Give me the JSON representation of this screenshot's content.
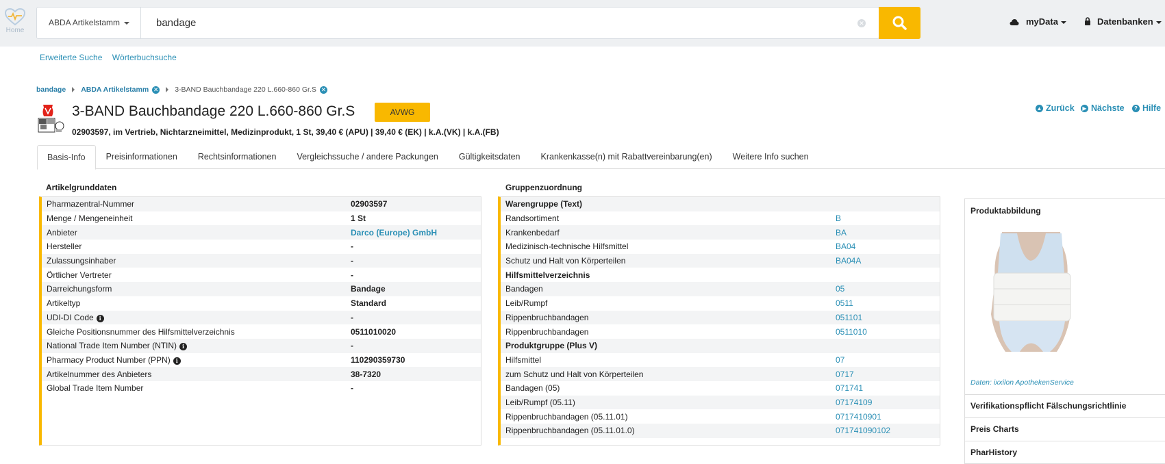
{
  "header": {
    "home_label": "Home",
    "db_select": "ABDA Artikelstamm",
    "search_value": "bandage",
    "mydata": "myData",
    "datenbanken": "Datenbanken"
  },
  "sublinks": [
    "Erweiterte Suche",
    "Wörterbuchsuche"
  ],
  "breadcrumb": {
    "items": [
      "bandage",
      "ABDA Artikelstamm",
      "3-BAND Bauchbandage 220 L.660-860 Gr.S"
    ]
  },
  "product": {
    "title": "3-BAND Bauchbandage 220 L.660-860 Gr.S",
    "badge": "AVWG",
    "subline": "02903597, im Vertrieb, Nichtarzneimittel, Medizinprodukt, 1 St, 39,40 € (APU) | 39,40 € (EK) | k.A.(VK) | k.A.(FB)"
  },
  "nav": {
    "back": "Zurück",
    "next": "Nächste",
    "help": "Hilfe"
  },
  "tabs": [
    "Basis-Info",
    "Preisinformationen",
    "Rechtsinformationen",
    "Vergleichssuche / andere Packungen",
    "Gültigkeitsdaten",
    "Krankenkasse(n) mit Rabattvereinbarung(en)",
    "Weitere Info suchen"
  ],
  "artikel": {
    "title": "Artikelgrunddaten",
    "rows": [
      {
        "k": "Pharmazentral-Nummer",
        "v": "02903597"
      },
      {
        "k": "Menge / Mengeneinheit",
        "v": "1 St"
      },
      {
        "k": "Anbieter",
        "v": "Darco (Europe) GmbH"
      },
      {
        "k": "Hersteller",
        "v": "-"
      },
      {
        "k": "Zulassungsinhaber",
        "v": "-"
      },
      {
        "k": "Örtlicher Vertreter",
        "v": "-"
      },
      {
        "k": "Darreichungsform",
        "v": "Bandage"
      },
      {
        "k": "Artikeltyp",
        "v": "Standard"
      },
      {
        "k": "UDI-DI Code",
        "v": "-"
      },
      {
        "k": "Gleiche Positionsnummer des Hilfsmittelverzeichnis",
        "v": "0511010020"
      },
      {
        "k": "National Trade Item Number (NTIN)",
        "v": "-"
      },
      {
        "k": "Pharmacy Product Number (PPN)",
        "v": "110290359730"
      },
      {
        "k": "Artikelnummer des Anbieters",
        "v": "38-7320"
      },
      {
        "k": "Global Trade Item Number",
        "v": "-"
      }
    ]
  },
  "gruppe": {
    "title": "Gruppenzuordnung",
    "rows": [
      {
        "k": "Warengruppe (Text)",
        "v": ""
      },
      {
        "k": "Randsortiment",
        "v": "B"
      },
      {
        "k": "Krankenbedarf",
        "v": "BA"
      },
      {
        "k": "Medizinisch-technische Hilfsmittel",
        "v": "BA04"
      },
      {
        "k": "Schutz und Halt von Körperteilen",
        "v": "BA04A"
      },
      {
        "k": "Hilfsmittelverzeichnis",
        "v": ""
      },
      {
        "k": "Bandagen",
        "v": "05"
      },
      {
        "k": "Leib/Rumpf",
        "v": "0511"
      },
      {
        "k": "Rippenbruchbandagen",
        "v": "051101"
      },
      {
        "k": "Rippenbruchbandagen",
        "v": "0511010"
      },
      {
        "k": "Produktgruppe (Plus V)",
        "v": ""
      },
      {
        "k": "Hilfsmittel",
        "v": "07"
      },
      {
        "k": "zum Schutz und Halt von Körperteilen",
        "v": "0717"
      },
      {
        "k": "Bandagen (05)",
        "v": "071741"
      },
      {
        "k": "Leib/Rumpf (05.11)",
        "v": "07174109"
      },
      {
        "k": "Rippenbruchbandagen (05.11.01)",
        "v": "0717410901"
      },
      {
        "k": "Rippenbruchbandagen (05.11.01.0)",
        "v": "071741090102"
      }
    ]
  },
  "right": {
    "title": "Produktabbildung",
    "caption": "Daten: ixxilon ApothekenService",
    "items": [
      "Verifikationspflicht Fälschungsrichtlinie",
      "Preis Charts",
      "PharHistory"
    ]
  }
}
